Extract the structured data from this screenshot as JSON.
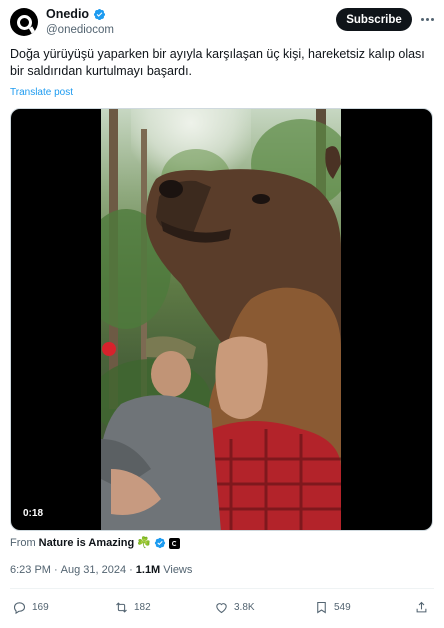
{
  "author": {
    "display_name": "Onedio",
    "handle": "@onediocom",
    "subscribe_label": "Subscribe"
  },
  "post": {
    "text": "Doğa yürüyüşü yaparken bir ayıyla karşılaşan üç kişi, hareketsiz kalıp olası bir saldırıdan kurtulmayı başardı.",
    "translate_label": "Translate post"
  },
  "media": {
    "timestamp": "0:18"
  },
  "source": {
    "prefix": "From",
    "name": "Nature is Amazing",
    "emoji": "☘️"
  },
  "meta": {
    "time": "6:23 PM",
    "separator1": "·",
    "date": "Aug 31, 2024",
    "separator2": "·",
    "views_count": "1.1M",
    "views_label": "Views"
  },
  "actions": {
    "replies": "169",
    "reposts": "182",
    "likes": "3.8K",
    "bookmarks": "549"
  },
  "colors": {
    "accent": "#1d9bf0",
    "text": "#0f1419",
    "secondary": "#536471"
  }
}
